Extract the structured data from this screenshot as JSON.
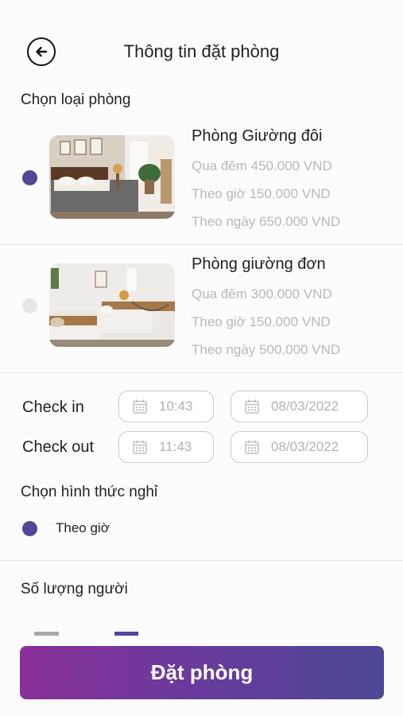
{
  "header": {
    "title": "Thông tin đặt phòng"
  },
  "room_section": {
    "label": "Chọn loại phòng"
  },
  "rooms": [
    {
      "name": "Phòng Giường đôi",
      "selected": true,
      "prices": [
        "Qua đêm 450.000 VND",
        "Theo giờ 150.000 VND",
        "Theo ngày 650.000 VND"
      ]
    },
    {
      "name": "Phòng giường đơn",
      "selected": false,
      "prices": [
        "Qua đêm 300.000 VND",
        "Theo giờ 150.000 VND",
        "Theo ngày 500.000 VND"
      ]
    }
  ],
  "checkin": {
    "label": "Check in",
    "time": "10:43",
    "date": "08/03/2022"
  },
  "checkout": {
    "label": "Check out",
    "time": "11:43",
    "date": "08/03/2022"
  },
  "stay_type": {
    "label": "Chọn hình thức nghỉ",
    "options": [
      {
        "label": "Theo giờ",
        "selected": true
      }
    ]
  },
  "guests": {
    "label": "Số lượng người"
  },
  "book_button": {
    "label": "Đặt phòng"
  },
  "colors": {
    "accent": "#54449a",
    "gradient_start": "#8a2f9a",
    "gradient_end": "#4b4896",
    "muted_text": "#b8b8bd"
  }
}
